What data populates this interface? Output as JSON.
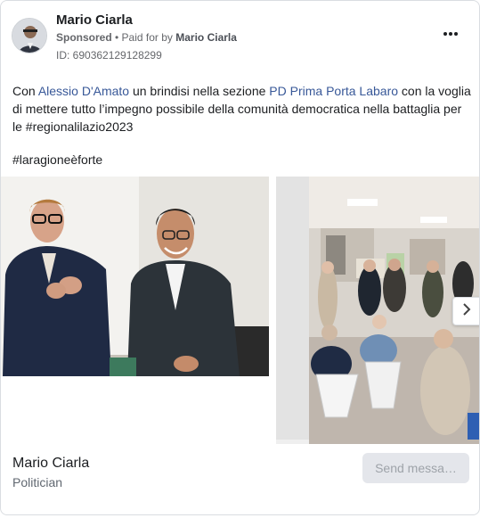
{
  "ad": {
    "page_name": "Mario Ciarla",
    "sponsored_label": "Sponsored",
    "separator": " • ",
    "paid_for_prefix": "Paid for by ",
    "payer": "Mario Ciarla",
    "library_id": "ID: 690362129128299",
    "more_icon": "more-horizontal-icon"
  },
  "post": {
    "t1": "Con ",
    "link1": "Alessio D'Amato",
    "t2": " un brindisi nella sezione ",
    "link2": "PD Prima Porta Labaro",
    "t3": " con la voglia di mettere tutto l’impegno possibile della comunità democratica nella battaglia per le #regionalilazio2023",
    "hashtag": "#laragioneèforte"
  },
  "carousel": {
    "next_icon": "chevron-right-icon",
    "slides": [
      {
        "alt": "Two men smiling, one applauding"
      },
      {
        "alt": "Crowd seated in a meeting room"
      }
    ]
  },
  "footer": {
    "name": "Mario Ciarla",
    "category": "Politician",
    "cta_label": "Send messa…"
  },
  "colors": {
    "link": "#385898",
    "muted": "#65676b",
    "cta_bg": "#e4e6eb",
    "cta_text": "#9ea3a9"
  }
}
